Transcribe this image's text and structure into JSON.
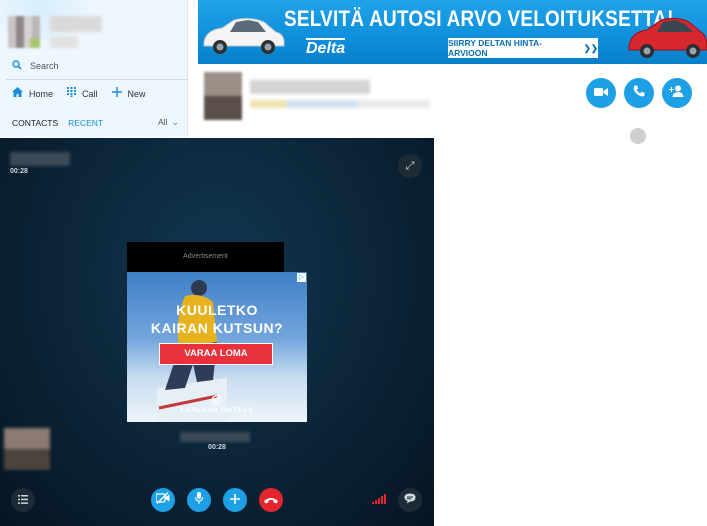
{
  "sidebar": {
    "search_placeholder": "Search",
    "nav": [
      {
        "label": "Home",
        "icon": "home-icon"
      },
      {
        "label": "Call",
        "icon": "dialpad-icon"
      },
      {
        "label": "New",
        "icon": "plus-icon"
      }
    ],
    "tabs": {
      "contacts": "CONTACTS",
      "recent": "RECENT",
      "filter": "All"
    }
  },
  "banner_ad": {
    "headline": "SELVITÄ AUTOSI ARVO VELOITUKSETTA!",
    "brand": "Delta",
    "cta": "SIIRRY DELTAN HINTA-ARVIOON",
    "cta_icon": "double-chevron-right-icon"
  },
  "conversation_header": {
    "buttons": [
      "video-call-icon",
      "audio-call-icon",
      "add-contact-icon"
    ]
  },
  "call": {
    "top_timer": "00:28",
    "ad_label": "Advertisement",
    "ad": {
      "line1": "KUULETKO",
      "line2": "KAIRAN KUTSUN?",
      "cta": "VARAA LOMA",
      "logo": "LAPLAND HOTELS"
    },
    "center_timer": "00:28",
    "controls": [
      "participants-icon",
      "video-off-icon",
      "mic-icon",
      "add-icon",
      "hang-up-icon",
      "signal-icon",
      "chat-icon"
    ]
  },
  "colors": {
    "accent": "#1ea0e6",
    "hangup": "#e3262e",
    "call_bg": "#0b2438"
  }
}
